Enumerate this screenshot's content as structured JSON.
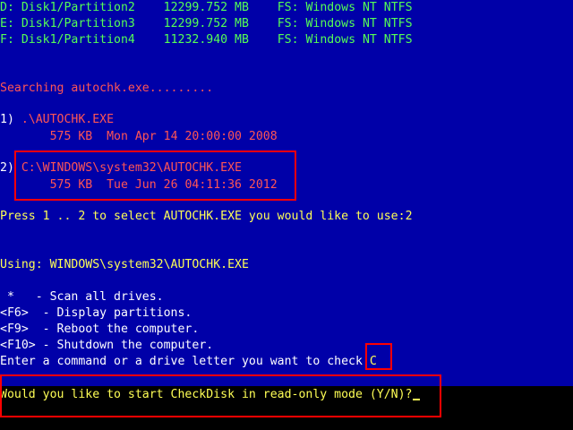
{
  "partitions": [
    {
      "drive": "D:",
      "path": "Disk1/Partition2",
      "size": "12299.752 MB",
      "fs": "FS: Windows NT NTFS"
    },
    {
      "drive": "E:",
      "path": "Disk1/Partition3",
      "size": "12299.752 MB",
      "fs": "FS: Windows NT NTFS"
    },
    {
      "drive": "F:",
      "path": "Disk1/Partition4",
      "size": "11232.940 MB",
      "fs": "FS: Windows NT NTFS"
    }
  ],
  "search_text": "Searching autochk.exe.........",
  "options": [
    {
      "number": "1)",
      "path": ".\\AUTOCHK.EXE",
      "size": "575 KB",
      "date": "Mon Apr 14 20:00:00 2008"
    },
    {
      "number": "2)",
      "path": "C:\\WINDOWS\\system32\\AUTOCHK.EXE",
      "size": "575 KB",
      "date": "Tue Jun 26 04:11:36 2012"
    }
  ],
  "select_prompt": "Press 1 .. 2 to select AUTOCHK.EXE you would like to use:",
  "select_answer": "2",
  "using_label": "Using: ",
  "using_path": "WINDOWS\\system32\\AUTOCHK.EXE",
  "commands": [
    {
      "key": " *  ",
      "desc": " - Scan all drives."
    },
    {
      "key": "<F6> ",
      "desc": " - Display partitions."
    },
    {
      "key": "<F9> ",
      "desc": " - Reboot the computer."
    },
    {
      "key": "<F10>",
      "desc": " - Shutdown the computer."
    }
  ],
  "command_prompt": "Enter a command or a drive letter you want to check:",
  "command_answer": "C",
  "readonly_prompt": "Would you like to start CheckDisk in read-only mode (Y/N)?",
  "colors": {
    "background": "#0000A8",
    "green": "#55FF55",
    "red": "#FF5555",
    "yellow": "#FFFF55",
    "highlight_box": "#FF0000"
  }
}
